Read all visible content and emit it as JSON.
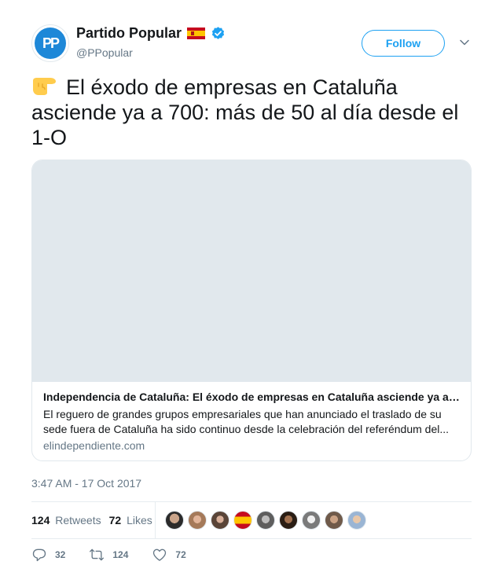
{
  "author": {
    "name": "Partido Popular",
    "handle": "@PPopular",
    "avatar_text": "PP",
    "flag_icon": "spain-flag-icon",
    "verified_icon": "verified-badge-icon"
  },
  "follow_button": {
    "label": "Follow"
  },
  "tweet": {
    "emoji_icon": "backhand-index-pointing-right-icon",
    "text": "El éxodo de empresas en Cataluña asciende ya a 700: más de 50 al día desde el 1-O"
  },
  "card": {
    "title": "Independencia de Cataluña: El éxodo de empresas en Cataluña asciende ya a…",
    "description": "El reguero de grandes grupos empresariales que han anunciado el traslado de su sede fuera de Cataluña ha sido continuo desde la celebración del referéndum del...",
    "domain": "elindependiente.com"
  },
  "timestamp": "3:47 AM - 17 Oct 2017",
  "stats": {
    "retweets_count": "124",
    "retweets_label": "Retweets",
    "likes_count": "72",
    "likes_label": "Likes"
  },
  "actions": {
    "reply_count": "32",
    "retweet_count": "124",
    "like_count": "72"
  },
  "colors": {
    "accent": "#1da1f2",
    "text": "#14171a",
    "muted": "#657786",
    "border": "#e1e8ed"
  }
}
